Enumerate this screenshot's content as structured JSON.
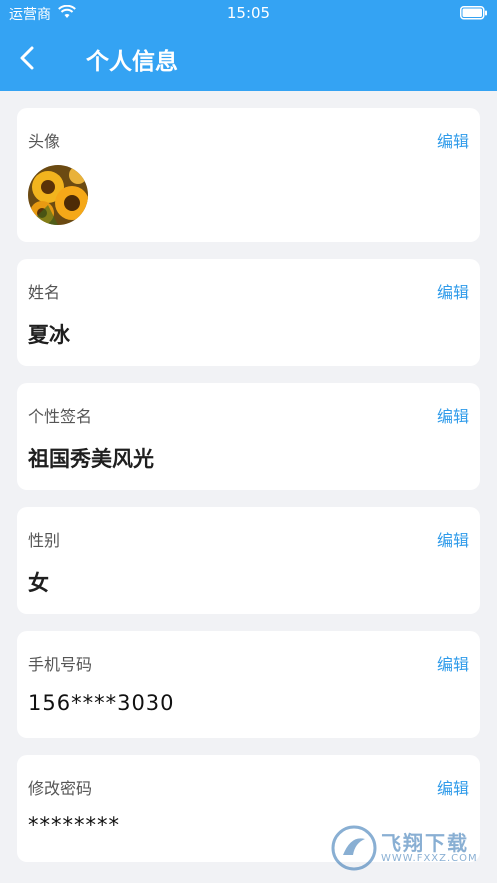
{
  "status_bar": {
    "carrier": "运营商",
    "time": "15:05"
  },
  "nav": {
    "title": "个人信息"
  },
  "fields": [
    {
      "label": "头像",
      "edit": "编辑"
    },
    {
      "label": "姓名",
      "value": "夏冰",
      "edit": "编辑"
    },
    {
      "label": "个性签名",
      "value": "祖国秀美风光",
      "edit": "编辑"
    },
    {
      "label": "性别",
      "value": "女",
      "edit": "编辑"
    },
    {
      "label": "手机号码",
      "value": "156****3030",
      "edit": "编辑"
    },
    {
      "label": "修改密码",
      "value": "********",
      "edit": "编辑"
    }
  ],
  "watermark": {
    "text": "飞翔下载",
    "url": "WWW.FXXZ.COM"
  },
  "colors": {
    "header": "#34a3f3",
    "edit_link": "#2f9bea",
    "background": "#f1f2f5"
  }
}
